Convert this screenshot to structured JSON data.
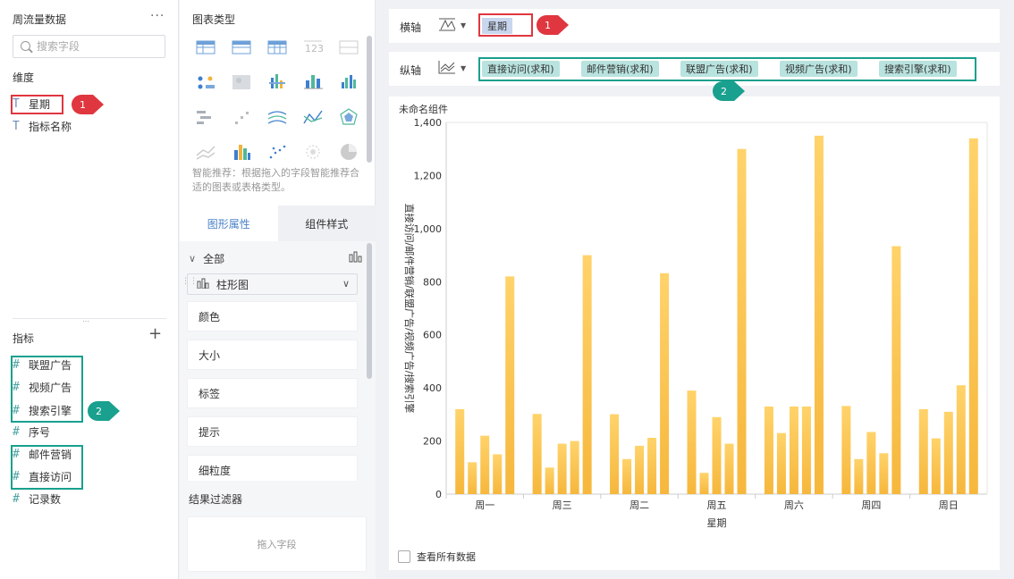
{
  "left_panel": {
    "dataset_title": "周流量数据",
    "more": "···",
    "search_placeholder": "搜索字段",
    "dimensions_label": "维度",
    "dimensions": [
      {
        "icon": "T",
        "label": "星期"
      },
      {
        "icon": "T",
        "label": "指标名称"
      }
    ],
    "measures_label": "指标",
    "add": "+",
    "measures": [
      {
        "icon": "#",
        "label": "联盟广告"
      },
      {
        "icon": "#",
        "label": "视频广告"
      },
      {
        "icon": "#",
        "label": "搜索引擎"
      },
      {
        "icon": "#",
        "label": "序号"
      },
      {
        "icon": "#",
        "label": "邮件营销"
      },
      {
        "icon": "#",
        "label": "直接访问"
      },
      {
        "icon": "#",
        "label": "记录数"
      }
    ]
  },
  "mid_panel": {
    "chart_types_title": "图表类型",
    "hint": "智能推荐：根据拖入的字段智能推荐合适的图表或表格类型。",
    "tabs": [
      "图形属性",
      "组件样式"
    ],
    "all_label": "全部",
    "chart_type_select": "柱形图",
    "properties": [
      "颜色",
      "大小",
      "标签",
      "提示",
      "细粒度"
    ],
    "filter_title": "结果过滤器",
    "drop_hint": "拖入字段"
  },
  "axes": {
    "x_label": "横轴",
    "x_fields": [
      "星期"
    ],
    "y_label": "纵轴",
    "y_fields": [
      "直接访问(求和)",
      "邮件营销(求和)",
      "联盟广告(求和)",
      "视频广告(求和)",
      "搜索引擎(求和)"
    ]
  },
  "annotations": {
    "one": "1",
    "two": "2"
  },
  "chart_card": {
    "title": "未命名组件",
    "view_all": "查看所有数据"
  },
  "colors": {
    "bar_top": "#ffd36b",
    "bar_bottom": "#f6b73c",
    "accent": "#4b82c9",
    "highlight_red": "#e0363f",
    "highlight_teal": "#19a08e"
  },
  "chart_data": {
    "type": "bar",
    "categories": [
      "周一",
      "周三",
      "周二",
      "周五",
      "周六",
      "周四",
      "周日"
    ],
    "series": [
      {
        "name": "直接访问(求和)",
        "values": [
          320,
          302,
          301,
          390,
          330,
          332,
          320
        ]
      },
      {
        "name": "邮件营销(求和)",
        "values": [
          120,
          100,
          132,
          80,
          230,
          132,
          210
        ]
      },
      {
        "name": "联盟广告(求和)",
        "values": [
          220,
          190,
          182,
          290,
          330,
          234,
          310
        ]
      },
      {
        "name": "视频广告(求和)",
        "values": [
          150,
          200,
          212,
          190,
          330,
          154,
          410
        ]
      },
      {
        "name": "搜索引擎(求和)",
        "values": [
          820,
          900,
          832,
          1300,
          1350,
          934,
          1340
        ]
      }
    ],
    "xlabel": "星期",
    "ylabel": "直接访问/邮件营销/联盟广告/视频广告/搜索引擎",
    "yticks": [
      "0",
      "200",
      "400",
      "600",
      "800",
      "1,000",
      "1,200",
      "1,400"
    ],
    "ylim": [
      0,
      1400
    ],
    "grid": false,
    "legend": "none"
  }
}
